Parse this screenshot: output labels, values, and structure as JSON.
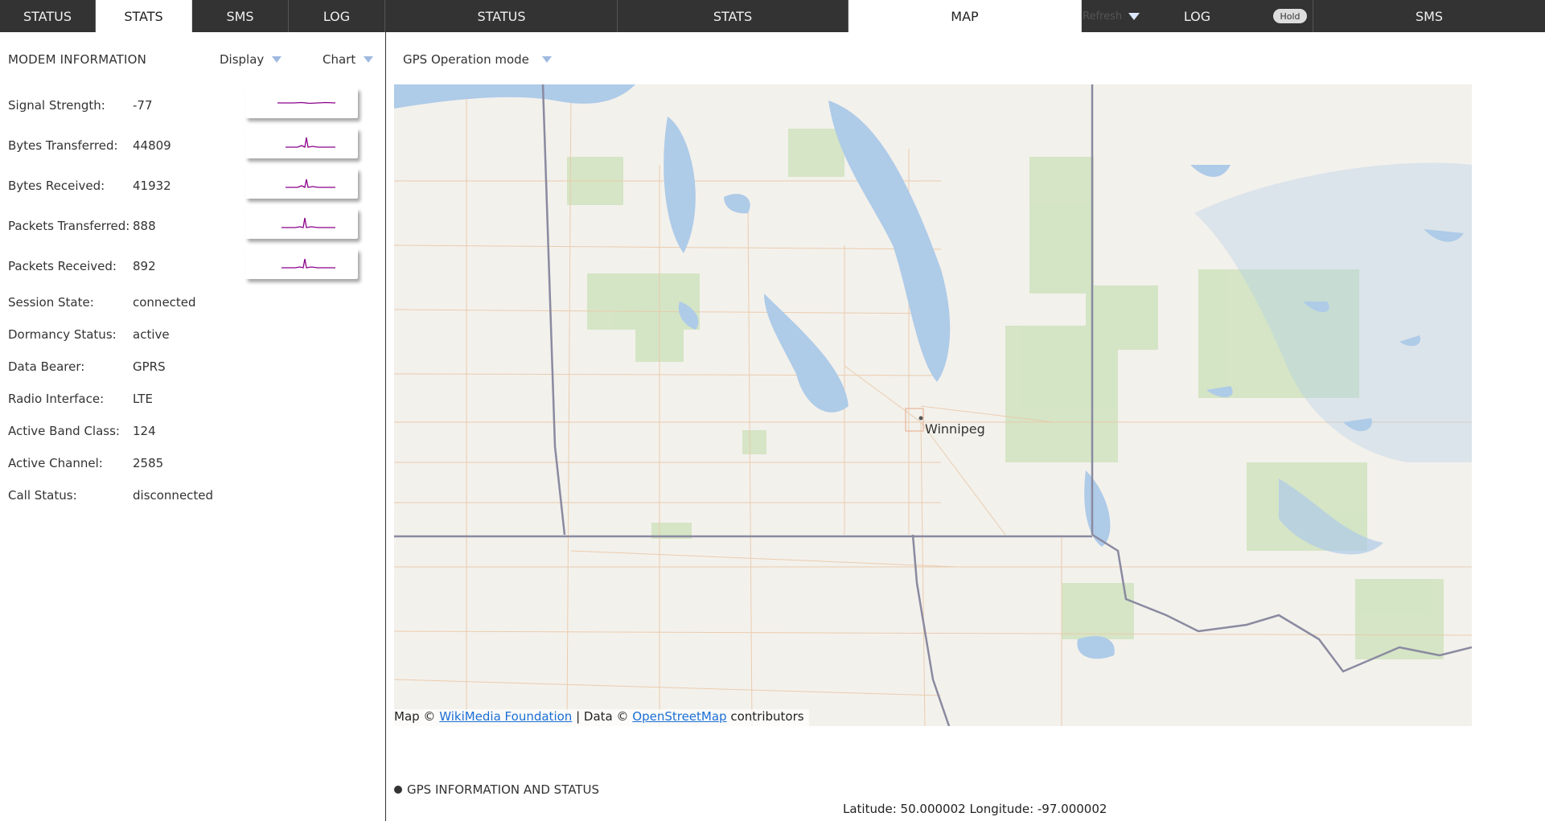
{
  "tabs_left": [
    {
      "label": "STATUS",
      "active": false
    },
    {
      "label": "STATS",
      "active": true
    },
    {
      "label": "SMS",
      "active": false
    },
    {
      "label": "LOG",
      "active": false
    }
  ],
  "tabs_right": [
    {
      "label": "STATUS",
      "active": false
    },
    {
      "label": "STATS",
      "active": false
    },
    {
      "label": "MAP",
      "active": true
    },
    {
      "label": "LOG",
      "active": false
    },
    {
      "label": "SMS",
      "active": false
    }
  ],
  "refresh": {
    "label": "Refresh",
    "icon": "caret-down-icon"
  },
  "hold": {
    "label": "Hold"
  },
  "modem": {
    "title": "MODEM INFORMATION",
    "display_dropdown": "Display",
    "chart_dropdown": "Chart",
    "stats": [
      {
        "label": "Signal Strength:",
        "value": "-77"
      },
      {
        "label": "Bytes Transferred:",
        "value": "44809"
      },
      {
        "label": "Bytes Received:",
        "value": "41932"
      },
      {
        "label": "Packets Transferred:",
        "value": "888"
      },
      {
        "label": "Packets Received:",
        "value": "892"
      }
    ],
    "details": [
      {
        "label": "Session State:",
        "value": "connected"
      },
      {
        "label": "Dormancy Status:",
        "value": "active"
      },
      {
        "label": "Data Bearer:",
        "value": "GPRS"
      },
      {
        "label": "Radio Interface:",
        "value": "LTE"
      },
      {
        "label": "Active Band Class:",
        "value": "124"
      },
      {
        "label": "Active Channel:",
        "value": "2585"
      },
      {
        "label": "Call Status:",
        "value": "disconnected"
      }
    ],
    "sparkline_color": "#8b008b"
  },
  "gps": {
    "mode_label": "GPS Operation mode",
    "section_title": "GPS INFORMATION AND STATUS",
    "latitude_text": "Latitude: 50.000002",
    "longitude_text": "Longitude: -97.000002"
  },
  "map": {
    "city_label": "Winnipeg",
    "attribution": {
      "prefix": "Map ©",
      "link1": "WikiMedia Foundation",
      "middle": "| Data ©",
      "link2": "OpenStreetMap",
      "suffix": "contributors"
    },
    "colors": {
      "land": "#f3f1ec",
      "water": "#aecbe8",
      "forest": "#cfe3bf",
      "roads": "#e9c9a8",
      "border": "#8a8aa0"
    }
  }
}
